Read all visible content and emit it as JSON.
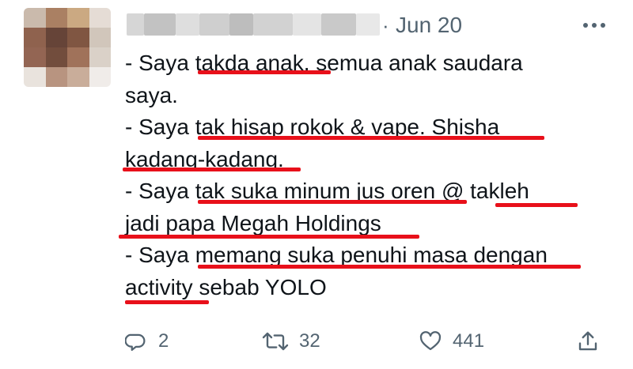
{
  "tweet": {
    "date": "Jun 20",
    "dot": "·",
    "lines": [
      "- Saya takda anak. semua anak saudara",
      "saya.",
      "- Saya tak hisap rokok & vape. Shisha",
      "kadang-kadang.",
      "- Saya tak suka minum jus oren @ takleh",
      "jadi papa Megah Holdings",
      "- Saya memang suka penuhi masa dengan",
      "activity sebab YOLO"
    ]
  },
  "actions": {
    "reply_count": "2",
    "retweet_count": "32",
    "like_count": "441"
  },
  "icons": {
    "reply": "reply-icon",
    "retweet": "retweet-icon",
    "like": "heart-icon",
    "share": "share-icon",
    "more": "more-icon"
  },
  "colors": {
    "text": "#0f1419",
    "muted": "#536471",
    "underline": "#e8101a"
  }
}
